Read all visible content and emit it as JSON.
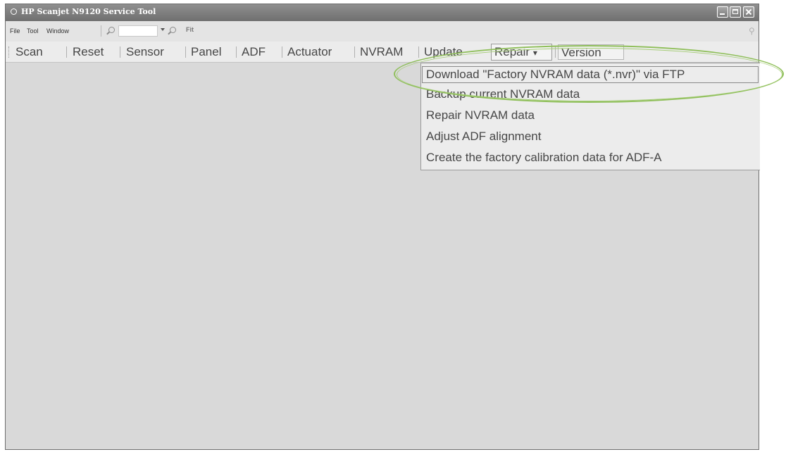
{
  "window": {
    "title": "HP Scanjet N9120 Service Tool"
  },
  "menubar": {
    "items": [
      "File",
      "Tool",
      "Window"
    ],
    "zoom_value": "",
    "fit_label": "Fit"
  },
  "toolbar": {
    "buttons": [
      "Scan",
      "Reset",
      "Sensor",
      "Panel",
      "ADF",
      "Actuator",
      "NVRAM",
      "Update",
      "Repair",
      "Version"
    ],
    "repair_arrow": "▾"
  },
  "repair_menu": {
    "items": [
      "Download \"Factory NVRAM data (*.nvr)\" via FTP",
      "Backup current NVRAM data",
      "Repair NVRAM data",
      "Adjust ADF alignment",
      "Create the factory calibration data for ADF-A"
    ]
  },
  "colors": {
    "highlight": "#8fbf5a",
    "titlebar": "#7f7f7f",
    "client_area": "#d9d9d9"
  },
  "icons": {
    "app": "app-circle-icon",
    "zoom_out": "magnifier-icon",
    "zoom_in": "magnifier-icon",
    "pin": "pin-icon"
  }
}
